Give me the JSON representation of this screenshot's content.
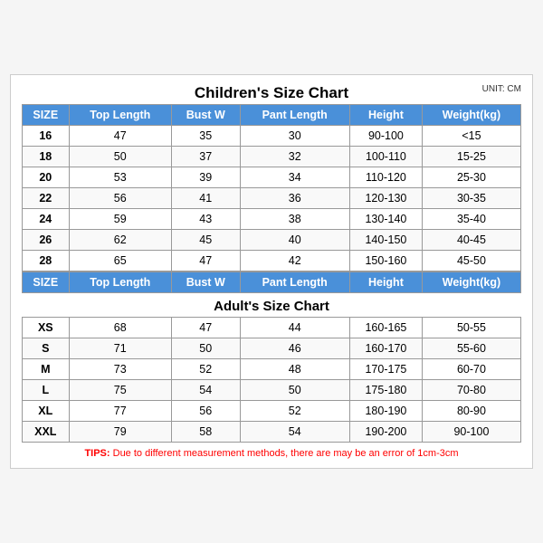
{
  "title": "Children's Size Chart",
  "unit": "UNIT: CM",
  "children": {
    "headers": [
      "SIZE",
      "Top Length",
      "Bust W",
      "Pant Length",
      "Height",
      "Weight(kg)"
    ],
    "rows": [
      [
        "16",
        "47",
        "35",
        "30",
        "90-100",
        "<15"
      ],
      [
        "18",
        "50",
        "37",
        "32",
        "100-110",
        "15-25"
      ],
      [
        "20",
        "53",
        "39",
        "34",
        "110-120",
        "25-30"
      ],
      [
        "22",
        "56",
        "41",
        "36",
        "120-130",
        "30-35"
      ],
      [
        "24",
        "59",
        "43",
        "38",
        "130-140",
        "35-40"
      ],
      [
        "26",
        "62",
        "45",
        "40",
        "140-150",
        "40-45"
      ],
      [
        "28",
        "65",
        "47",
        "42",
        "150-160",
        "45-50"
      ]
    ]
  },
  "adults": {
    "section_title": "Adult's Size Chart",
    "headers": [
      "SIZE",
      "Top Length",
      "Bust W",
      "Pant Length",
      "Height",
      "Weight(kg)"
    ],
    "rows": [
      [
        "XS",
        "68",
        "47",
        "44",
        "160-165",
        "50-55"
      ],
      [
        "S",
        "71",
        "50",
        "46",
        "160-170",
        "55-60"
      ],
      [
        "M",
        "73",
        "52",
        "48",
        "170-175",
        "60-70"
      ],
      [
        "L",
        "75",
        "54",
        "50",
        "175-180",
        "70-80"
      ],
      [
        "XL",
        "77",
        "56",
        "52",
        "180-190",
        "80-90"
      ],
      [
        "XXL",
        "79",
        "58",
        "54",
        "190-200",
        "90-100"
      ]
    ]
  },
  "tips": {
    "label": "TIPS:",
    "text": " Due to different measurement methods, there are may be an error of 1cm-3cm"
  }
}
